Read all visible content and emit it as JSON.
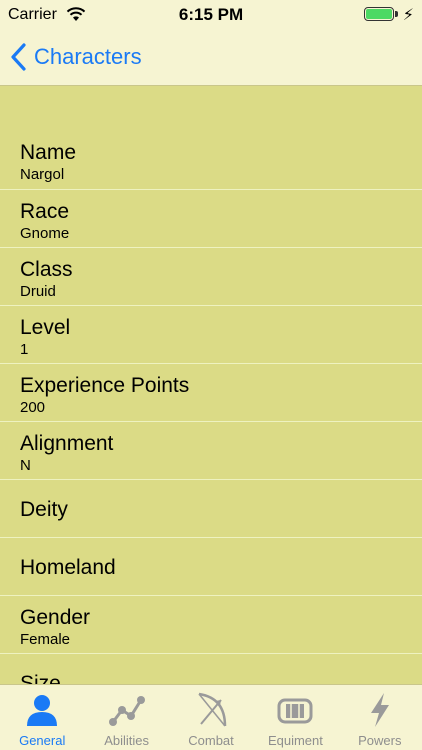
{
  "status_bar": {
    "carrier": "Carrier",
    "time": "6:15 PM",
    "battery_level": 1.0
  },
  "nav": {
    "back_label": "Characters"
  },
  "fields": [
    {
      "title": "Name",
      "value": "Nargol"
    },
    {
      "title": "Race",
      "value": "Gnome"
    },
    {
      "title": "Class",
      "value": "Druid"
    },
    {
      "title": "Level",
      "value": "1"
    },
    {
      "title": "Experience Points",
      "value": "200"
    },
    {
      "title": "Alignment",
      "value": "N"
    },
    {
      "title": "Deity",
      "value": ""
    },
    {
      "title": "Homeland",
      "value": ""
    },
    {
      "title": "Gender",
      "value": "Female"
    },
    {
      "title": "Size",
      "value": ""
    }
  ],
  "tabs": [
    {
      "label": "General",
      "icon": "person-icon",
      "active": true
    },
    {
      "label": "Abilities",
      "icon": "line-graph-icon",
      "active": false
    },
    {
      "label": "Combat",
      "icon": "bow-icon",
      "active": false
    },
    {
      "label": "Equiment",
      "icon": "armor-icon",
      "active": false
    },
    {
      "label": "Powers",
      "icon": "lightning-icon",
      "active": false
    }
  ],
  "colors": {
    "accent": "#1a7af5",
    "background": "#dbdb86",
    "bar": "#f6f4d2",
    "inactive_tab": "#8e8e8e"
  }
}
